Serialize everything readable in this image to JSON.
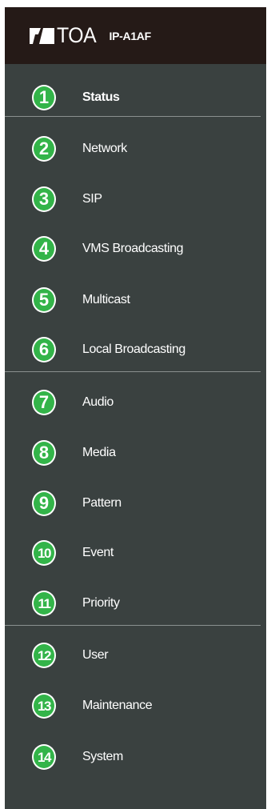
{
  "header": {
    "brand": "TOA",
    "model": "IP-A1AF",
    "logo_icon": "toa-logo-icon"
  },
  "menu": {
    "accent_color": "#33b449",
    "items": [
      {
        "num": "1",
        "label": "Status",
        "active": true
      },
      {
        "num": "2",
        "label": "Network"
      },
      {
        "num": "3",
        "label": "SIP"
      },
      {
        "num": "4",
        "label": "VMS Broadcasting"
      },
      {
        "num": "5",
        "label": "Multicast"
      },
      {
        "num": "6",
        "label": "Local Broadcasting"
      },
      {
        "num": "7",
        "label": "Audio"
      },
      {
        "num": "8",
        "label": "Media"
      },
      {
        "num": "9",
        "label": "Pattern"
      },
      {
        "num": "10",
        "label": "Event"
      },
      {
        "num": "11",
        "label": "Priority"
      },
      {
        "num": "12",
        "label": "User"
      },
      {
        "num": "13",
        "label": "Maintenance"
      },
      {
        "num": "14",
        "label": "System"
      }
    ]
  }
}
